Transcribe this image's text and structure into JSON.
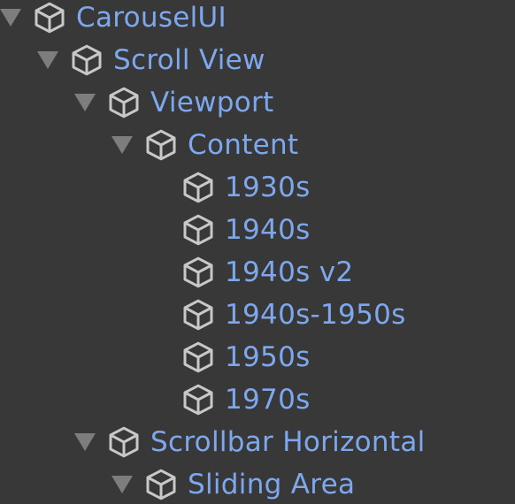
{
  "hierarchy": {
    "items": [
      {
        "label": "CarouselUI",
        "expanded": true,
        "has_children": true,
        "icon": "cube-icon"
      },
      {
        "label": "Scroll View",
        "expanded": true,
        "has_children": true,
        "icon": "cube-icon"
      },
      {
        "label": "Viewport",
        "expanded": true,
        "has_children": true,
        "icon": "cube-icon"
      },
      {
        "label": "Content",
        "expanded": true,
        "has_children": true,
        "icon": "cube-icon"
      },
      {
        "label": "1930s",
        "expanded": false,
        "has_children": false,
        "icon": "cube-icon"
      },
      {
        "label": "1940s",
        "expanded": false,
        "has_children": false,
        "icon": "cube-icon"
      },
      {
        "label": "1940s v2",
        "expanded": false,
        "has_children": false,
        "icon": "cube-icon"
      },
      {
        "label": "1940s-1950s",
        "expanded": false,
        "has_children": false,
        "icon": "cube-icon"
      },
      {
        "label": "1950s",
        "expanded": false,
        "has_children": false,
        "icon": "cube-icon"
      },
      {
        "label": "1970s",
        "expanded": false,
        "has_children": false,
        "icon": "cube-icon"
      },
      {
        "label": "Scrollbar Horizontal",
        "expanded": true,
        "has_children": true,
        "icon": "cube-icon"
      },
      {
        "label": "Sliding Area",
        "expanded": true,
        "has_children": true,
        "icon": "cube-icon"
      }
    ]
  },
  "colors": {
    "background": "#383838",
    "label": "#7ea8ee",
    "icon": "#c8c8c8",
    "arrow": "#7d7d7d"
  }
}
